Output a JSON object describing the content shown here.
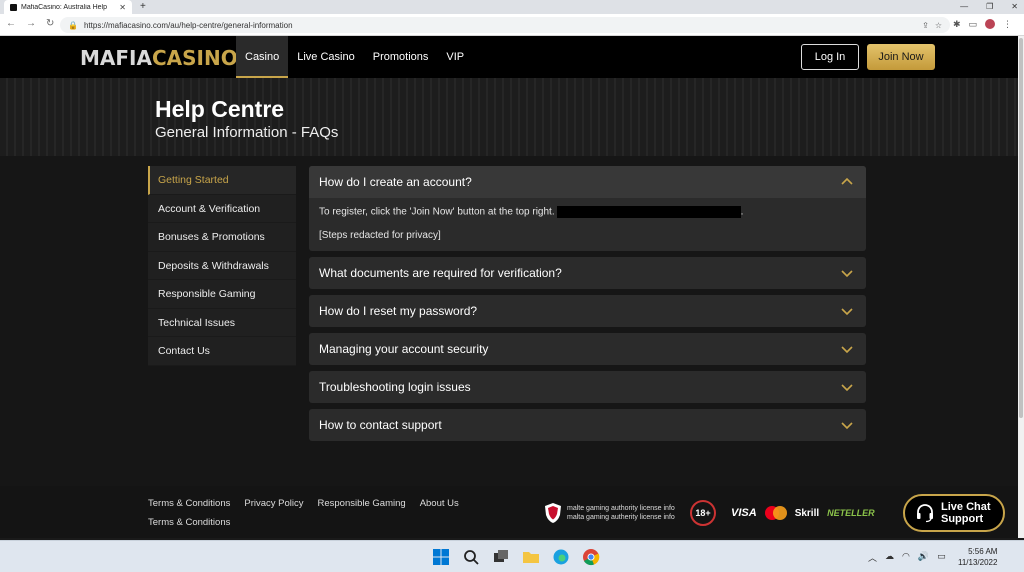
{
  "browser": {
    "tab_title": "MafiaCasino: Australia Help",
    "url": "https://mafiacasino.com/au/help-centre/general-information"
  },
  "header": {
    "logo_left": "MAFIA",
    "logo_right": "CASINO",
    "nav": [
      {
        "label": "Casino",
        "active": true
      },
      {
        "label": "Live Casino",
        "active": false
      },
      {
        "label": "Promotions",
        "active": false
      },
      {
        "label": "VIP",
        "active": false
      }
    ],
    "login_label": "Log In",
    "join_label": "Join Now"
  },
  "hero": {
    "title": "Help Centre",
    "subtitle": "General Information - FAQs"
  },
  "sidebar": {
    "items": [
      {
        "label": "Getting Started",
        "active": true
      },
      {
        "label": "Account & Verification"
      },
      {
        "label": "Bonuses & Promotions"
      },
      {
        "label": "Deposits & Withdrawals"
      },
      {
        "label": "Responsible Gaming"
      },
      {
        "label": "Technical Issues"
      },
      {
        "label": "Contact Us"
      }
    ]
  },
  "faq": {
    "items": [
      {
        "question": "How do I create an account?",
        "open": true,
        "answer_line1": "To register, click the 'Join Now' button at the top right.",
        "answer_line2": "[Steps redacted for privacy]"
      },
      {
        "question": "What documents are required for verification?"
      },
      {
        "question": "How do I reset my password?"
      },
      {
        "question": "Managing your account security"
      },
      {
        "question": "Troubleshooting login issues"
      },
      {
        "question": "How to contact support"
      }
    ]
  },
  "footer": {
    "links_row1": [
      "Terms & Conditions",
      "Privacy Policy",
      "Responsible Gaming",
      "About Us"
    ],
    "links_row2": [
      "Terms & Conditions"
    ],
    "mga_line1": "malte gaming authority license info",
    "mga_line2": "malta gaming autherity license info",
    "age_badge": "18+",
    "payments": {
      "visa": "VISA",
      "skrill": "Skrill",
      "neteller": "NETELLER"
    },
    "live_chat_line1": "Live Chat",
    "live_chat_line2": "Support"
  },
  "taskbar": {
    "time": "5:56 AM",
    "date": "11/13/2022"
  },
  "colors": {
    "gold": "#c8a54a",
    "panel": "#2b2b2b",
    "background": "#161616"
  }
}
